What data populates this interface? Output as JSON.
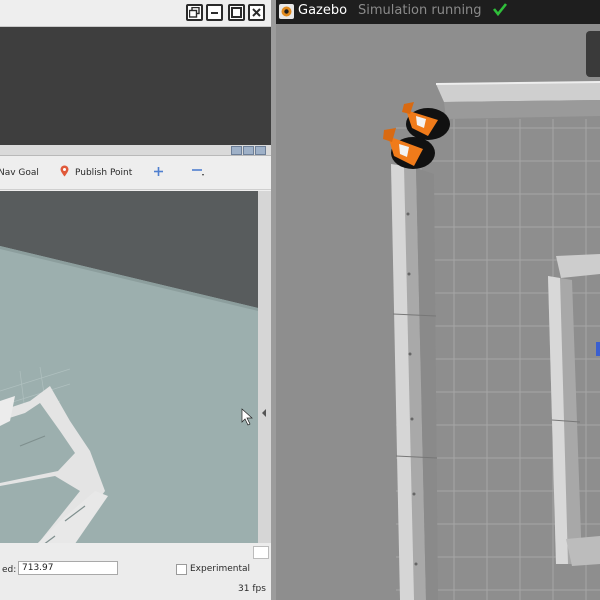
{
  "rviz": {
    "toolbar": {
      "nav_goal_label": "Nav Goal",
      "publish_point_label": "Publish Point"
    },
    "status": {
      "speed_label": "ed:",
      "speed_value": "713.97",
      "experimental_label": "Experimental",
      "fps": "31 fps"
    }
  },
  "gazebo": {
    "title": "Gazebo",
    "status": "Simulation running",
    "status_icon": "checkmark-icon",
    "status_color": "#2fbf3a"
  }
}
